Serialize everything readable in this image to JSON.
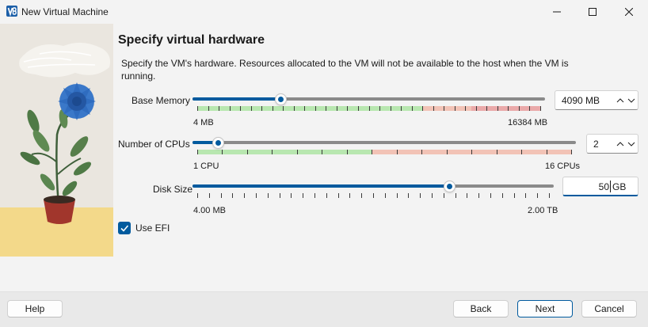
{
  "window": {
    "title": "New Virtual Machine"
  },
  "page": {
    "title": "Specify virtual hardware",
    "description": "Specify the VM's hardware. Resources allocated to the VM will not be available to the host when the VM is running."
  },
  "memory": {
    "label": "Base Memory",
    "min_label": "4 MB",
    "max_label": "16384 MB",
    "value_text": "4090 MB",
    "value_mb": 4090,
    "min_mb": 4,
    "max_mb": 16384,
    "zones": [
      {
        "kind": "ok",
        "color": "#b8e7b0",
        "from_mb": 4,
        "to_mb": 10800
      },
      {
        "kind": "warning",
        "color": "#f2c3b6",
        "from_mb": 10800,
        "to_mb": 13100
      },
      {
        "kind": "danger",
        "color": "#eaa9a9",
        "from_mb": 13100,
        "to_mb": 16384
      }
    ]
  },
  "cpus": {
    "label": "Number of CPUs",
    "min_label": "1 CPU",
    "max_label": "16 CPUs",
    "value_text": "2",
    "value": 2,
    "min": 1,
    "max": 16,
    "zones": [
      {
        "kind": "ok",
        "color": "#b8e7b0",
        "from": 1,
        "to": 8
      },
      {
        "kind": "warning",
        "color": "#f2c3b6",
        "from": 8,
        "to": 16
      }
    ]
  },
  "disk": {
    "label": "Disk Size",
    "min_label": "4.00 MB",
    "max_label": "2.00 TB",
    "value_text": "50",
    "unit": "GB",
    "position_fraction": 0.71
  },
  "efi": {
    "label": "Use EFI",
    "checked": true
  },
  "buttons": {
    "help": "Help",
    "back": "Back",
    "next": "Next",
    "cancel": "Cancel"
  },
  "colors": {
    "accent": "#005a9e",
    "track": "#8a8a8a",
    "ok_zone": "#b8e7b0",
    "warning_zone": "#f2c3b6",
    "danger_zone": "#eaa9a9"
  },
  "icons": {
    "app": "virtualbox-logo-icon",
    "minimize": "minimize-icon",
    "maximize": "maximize-icon",
    "close": "close-icon",
    "spin": "chevron-up-down-icon",
    "check": "checkmark-icon"
  }
}
